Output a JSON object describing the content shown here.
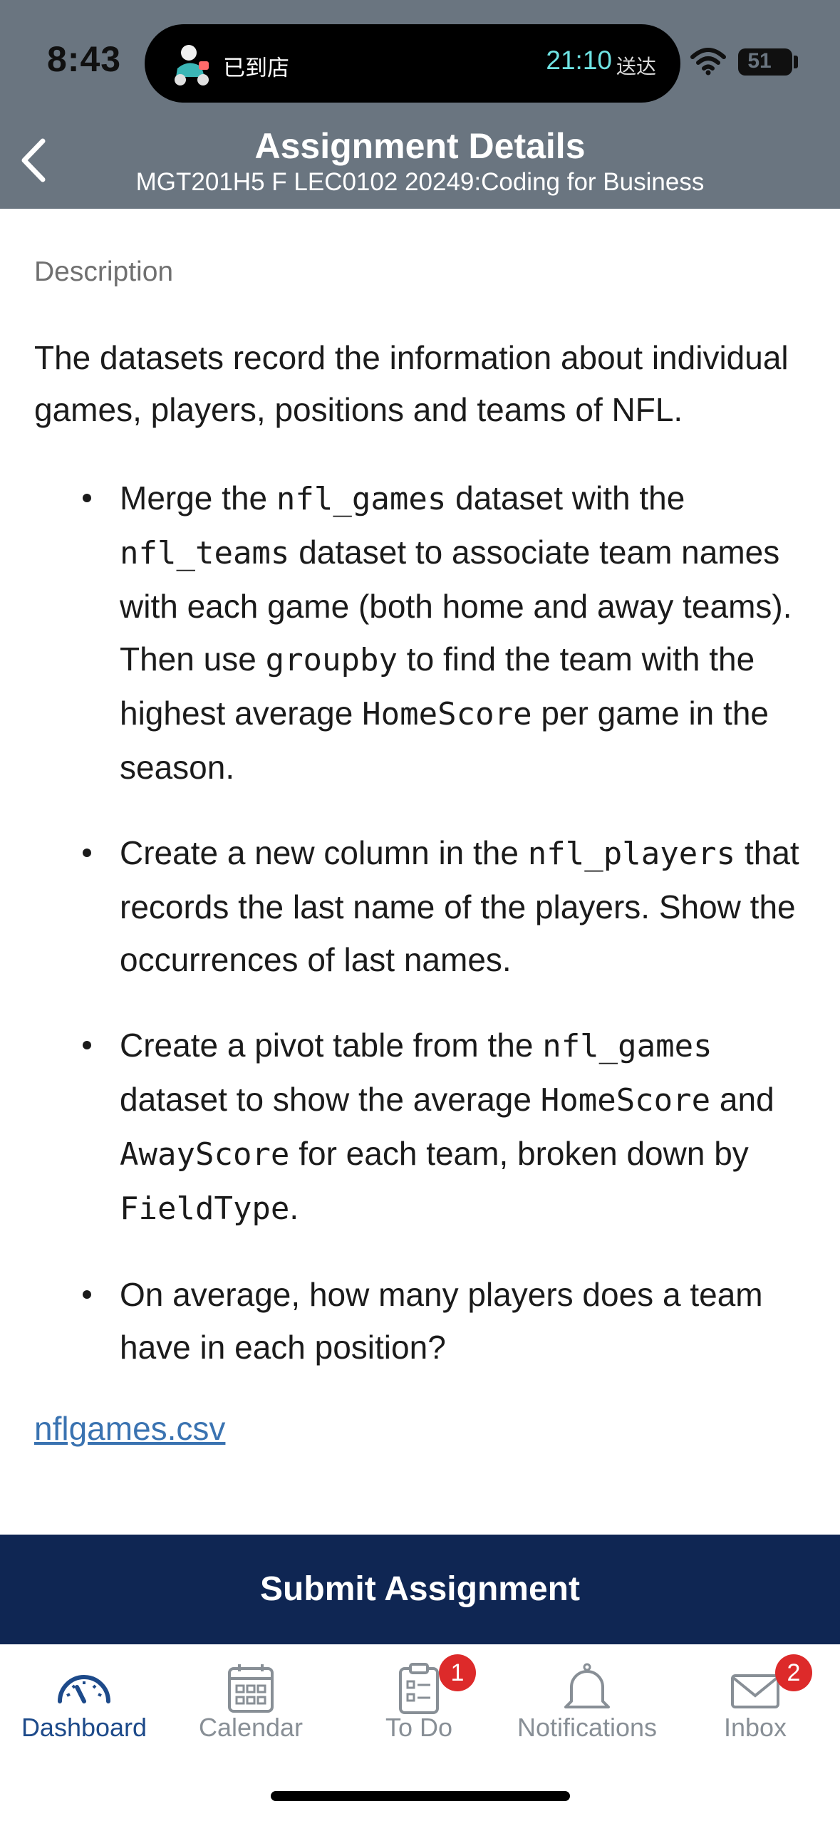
{
  "status": {
    "time": "8:43",
    "battery": "51",
    "island_store": "已到店",
    "island_eta": "21:10",
    "island_eta_label": "送达"
  },
  "header": {
    "title": "Assignment Details",
    "subtitle": "MGT201H5 F LEC0102 20249:Coding for Business"
  },
  "content": {
    "description_label": "Description",
    "intro": "The datasets record the information about individual games, players, positions and teams of NFL.",
    "bullets": [
      {
        "parts": [
          {
            "t": "Merge the ",
            "c": false
          },
          {
            "t": "nfl_games",
            "c": true
          },
          {
            "t": " dataset with the ",
            "c": false
          },
          {
            "t": "nfl_teams",
            "c": true
          },
          {
            "t": " dataset to associate team names with each game (both home and away teams). Then use ",
            "c": false
          },
          {
            "t": "groupby",
            "c": true
          },
          {
            "t": " to find the team with the highest average ",
            "c": false
          },
          {
            "t": "HomeScore",
            "c": true
          },
          {
            "t": " per game in the season.",
            "c": false
          }
        ]
      },
      {
        "parts": [
          {
            "t": "Create a new column in the ",
            "c": false
          },
          {
            "t": "nfl_players",
            "c": true
          },
          {
            "t": " that records the last name of the players. Show the occurrences of last names.",
            "c": false
          }
        ]
      },
      {
        "parts": [
          {
            "t": "Create a pivot table from the ",
            "c": false
          },
          {
            "t": "nfl_games",
            "c": true
          },
          {
            "t": " dataset to show the average ",
            "c": false
          },
          {
            "t": "HomeScore",
            "c": true
          },
          {
            "t": " and ",
            "c": false
          },
          {
            "t": "AwayScore",
            "c": true
          },
          {
            "t": " for each team, broken down by ",
            "c": false
          },
          {
            "t": "FieldType",
            "c": true
          },
          {
            "t": ".",
            "c": false
          }
        ]
      },
      {
        "parts": [
          {
            "t": "On average, how many players does a team have in each position?",
            "c": false
          }
        ]
      }
    ],
    "file_link": "nflgames.csv"
  },
  "submit_label": "Submit Assignment",
  "tabs": [
    {
      "label": "Dashboard",
      "icon": "dashboard-icon",
      "badge": ""
    },
    {
      "label": "Calendar",
      "icon": "calendar-icon",
      "badge": ""
    },
    {
      "label": "To Do",
      "icon": "todo-icon",
      "badge": "1"
    },
    {
      "label": "Notifications",
      "icon": "bell-icon",
      "badge": ""
    },
    {
      "label": "Inbox",
      "icon": "inbox-icon",
      "badge": "2"
    }
  ],
  "colors": {
    "header_bg": "#6a7580",
    "submit_bg": "#0f2653",
    "active_tab": "#1d4a8a",
    "link": "#3a73b1",
    "badge": "#dd2a2a"
  }
}
